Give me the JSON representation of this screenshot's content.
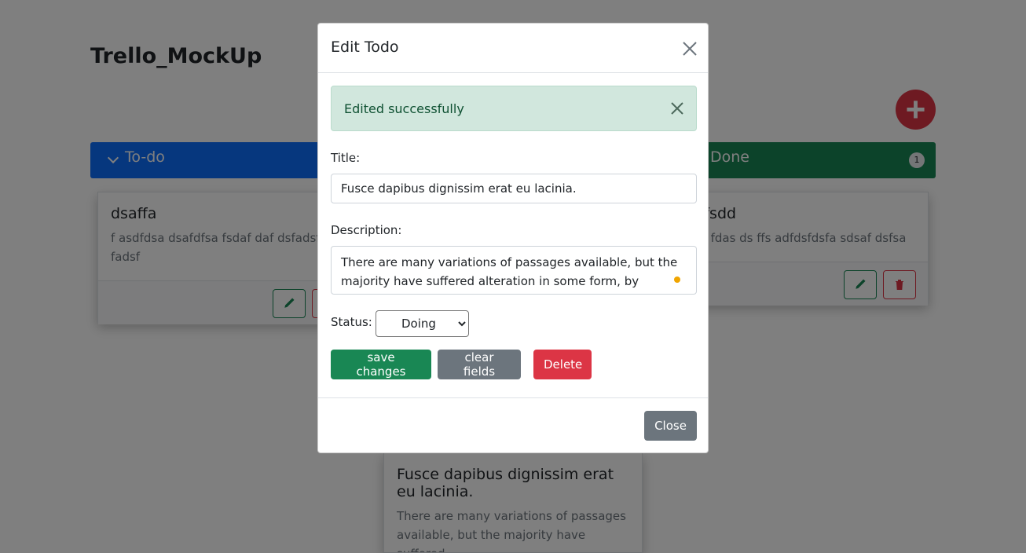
{
  "app": {
    "title": "Trello_MockUp",
    "add_button": "+"
  },
  "columns": {
    "todo": {
      "label": "To-do"
    },
    "done": {
      "label": "Done",
      "count": "1"
    }
  },
  "cards": [
    {
      "title": "dsaffa",
      "description": "f asdfdsa dsafdfsa fsdaf daf dsfadsfd fadsf"
    },
    {
      "title": "dsffsdd",
      "description": "fdas fdas ds ffs adfdsfdsfa sdsaf dsfsa"
    },
    {
      "title": "Fusce dapibus dignissim erat eu lacinia.",
      "description": "There are many variations of passages available, but the majority have suffered"
    }
  ],
  "modal": {
    "title": "Edit Todo",
    "alert": "Edited successfully",
    "title_label": "Title:",
    "title_value": "Fusce dapibus dignissim erat eu lacinia.",
    "description_label": "Description:",
    "description_value": "There are many variations of passages available, but the majority have suffered alteration in some form, by injected humour",
    "status_label": "Status:",
    "status_value": "Doing",
    "save_label": "save changes",
    "clear_label": "clear fields",
    "delete_label": "Delete",
    "close_label": "Close"
  },
  "colors": {
    "primary": "#0d6efd",
    "success": "#198754",
    "danger": "#dc3545",
    "secondary": "#6c757d",
    "alert_bg": "#d1e7dd"
  }
}
